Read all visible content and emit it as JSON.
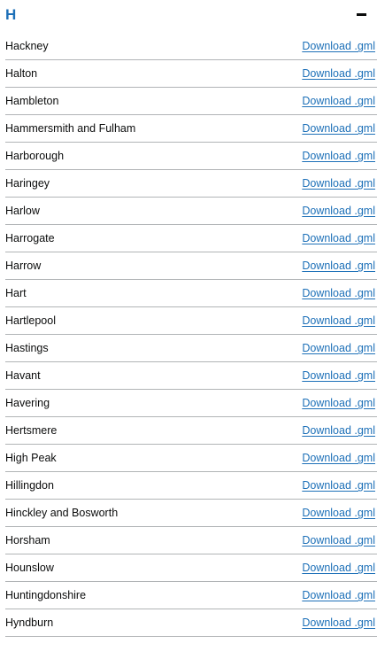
{
  "section": {
    "letter": "H",
    "toggle_icon": "minus-icon"
  },
  "link_label": "Download .gml",
  "items": [
    "Hackney",
    "Halton",
    "Hambleton",
    "Hammersmith and Fulham",
    "Harborough",
    "Haringey",
    "Harlow",
    "Harrogate",
    "Harrow",
    "Hart",
    "Hartlepool",
    "Hastings",
    "Havant",
    "Havering",
    "Hertsmere",
    "High Peak",
    "Hillingdon",
    "Hinckley and Bosworth",
    "Horsham",
    "Hounslow",
    "Huntingdonshire",
    "Hyndburn"
  ],
  "colors": {
    "link": "#1d70b8",
    "heading": "#1d70b8",
    "text": "#0b0c0c",
    "divider": "#b1b4b6"
  }
}
